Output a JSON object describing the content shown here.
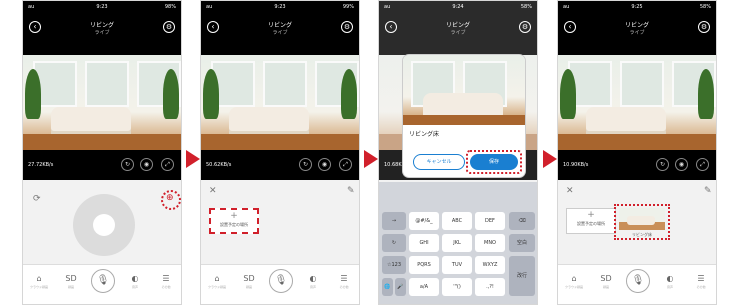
{
  "panels": [
    {
      "status": {
        "carrier": "au",
        "time": "9:23",
        "battery": "98%"
      },
      "title": "リビング",
      "subtitle": "ライブ",
      "speed": "27.72KB/s",
      "tabs": [
        {
          "icon": "⌂",
          "label": "クラウド録画"
        },
        {
          "icon": "SD",
          "label": "録画"
        },
        {
          "icon": "◐",
          "label": "音声"
        },
        {
          "icon": "☰",
          "label": "その他"
        }
      ]
    },
    {
      "status": {
        "carrier": "au",
        "time": "9:23",
        "battery": "99%"
      },
      "title": "リビング",
      "subtitle": "ライブ",
      "speed": "50.62KB/s",
      "add_label": "設置予定の場所",
      "tabs": [
        {
          "icon": "⌂",
          "label": "クラウド録画"
        },
        {
          "icon": "SD",
          "label": "録画"
        },
        {
          "icon": "◐",
          "label": "音声"
        },
        {
          "icon": "☰",
          "label": "その他"
        }
      ]
    },
    {
      "status": {
        "carrier": "au",
        "time": "9:24",
        "battery": "58%"
      },
      "title": "リビング",
      "subtitle": "ライブ",
      "speed": "10.68KB/s",
      "dialog": {
        "input_value": "リビング床",
        "cancel": "キャンセル",
        "save": "保存"
      },
      "keyboard": {
        "row1": [
          "→",
          "@#/&_",
          "ABC",
          "DEF",
          "⌫"
        ],
        "row2": [
          "↻",
          "GHI",
          "JKL",
          "MNO",
          "空白"
        ],
        "row3": [
          "☆123",
          "PQRS",
          "TUV",
          "WXYZ",
          "改行"
        ],
        "row4": [
          "🌐",
          "🎤",
          "a/A",
          "'\"()",
          ".,?!"
        ]
      }
    },
    {
      "status": {
        "carrier": "au",
        "time": "9:25",
        "battery": "58%"
      },
      "title": "リビング",
      "subtitle": "ライブ",
      "speed": "10.90KB/s",
      "add_label": "設置予定の場所",
      "saved_label": "リビング床",
      "tabs": [
        {
          "icon": "⌂",
          "label": "クラウド録画"
        },
        {
          "icon": "SD",
          "label": "録画"
        },
        {
          "icon": "◐",
          "label": "音声"
        },
        {
          "icon": "☰",
          "label": "その他"
        }
      ]
    }
  ],
  "colors": {
    "accent_red": "#d1202b",
    "primary_blue": "#1a7fd1"
  }
}
